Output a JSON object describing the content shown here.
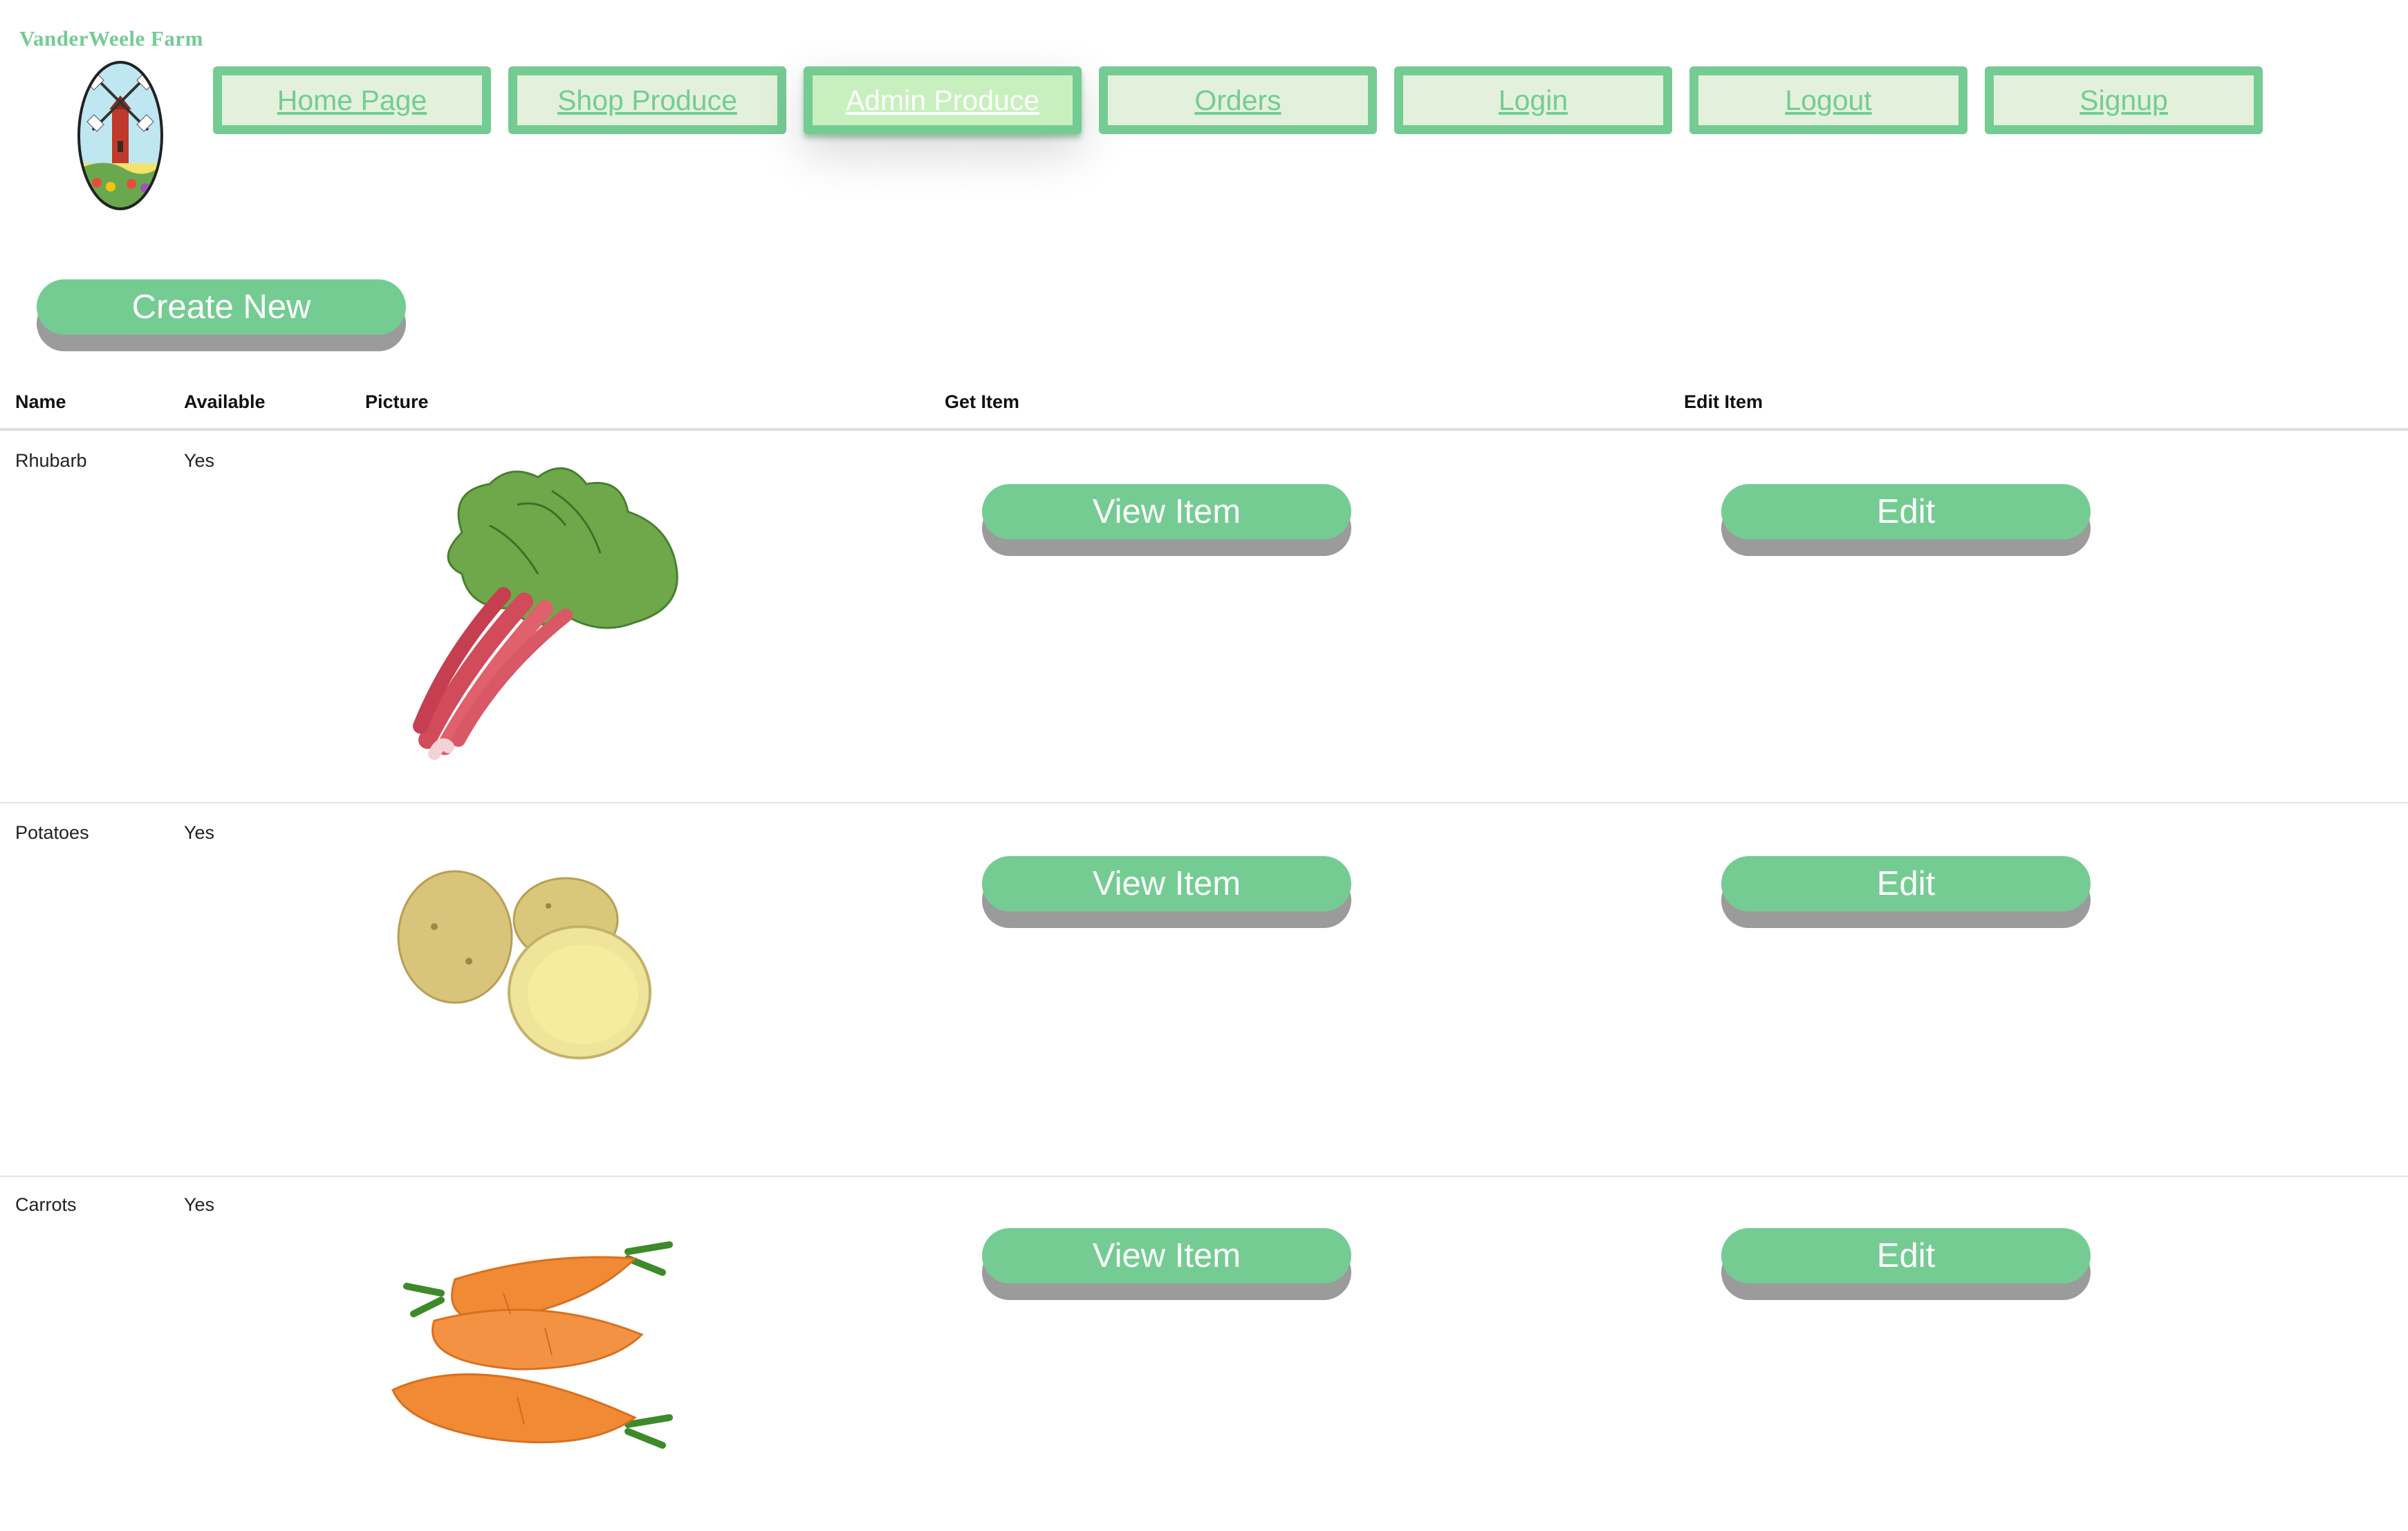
{
  "header": {
    "brand": "VanderWeele Farm",
    "logo_icon": "windmill-logo-icon"
  },
  "nav": {
    "items": [
      {
        "label": "Home Page",
        "active": false
      },
      {
        "label": "Shop Produce",
        "active": false
      },
      {
        "label": "Admin Produce",
        "active": true
      },
      {
        "label": "Orders",
        "active": false
      },
      {
        "label": "Login",
        "active": false
      },
      {
        "label": "Logout",
        "active": false
      },
      {
        "label": "Signup",
        "active": false
      }
    ]
  },
  "actions": {
    "create_label": "Create New"
  },
  "table": {
    "headers": [
      "Name",
      "Available",
      "Picture",
      "Get Item",
      "Edit Item"
    ],
    "rows": [
      {
        "name": "Rhubarb",
        "available": "Yes",
        "image_icon": "rhubarb-image",
        "view_label": "View Item",
        "edit_label": "Edit"
      },
      {
        "name": "Potatoes",
        "available": "Yes",
        "image_icon": "potatoes-image",
        "view_label": "View Item",
        "edit_label": "Edit"
      },
      {
        "name": "Carrots",
        "available": "Yes",
        "image_icon": "carrots-image",
        "view_label": "View Item",
        "edit_label": "Edit"
      }
    ]
  },
  "colors": {
    "accent": "#74cc93",
    "nav_bg": "#e3f1dc",
    "nav_active_bg": "#c8f0be",
    "button_shadow": "#9b9b9b"
  }
}
